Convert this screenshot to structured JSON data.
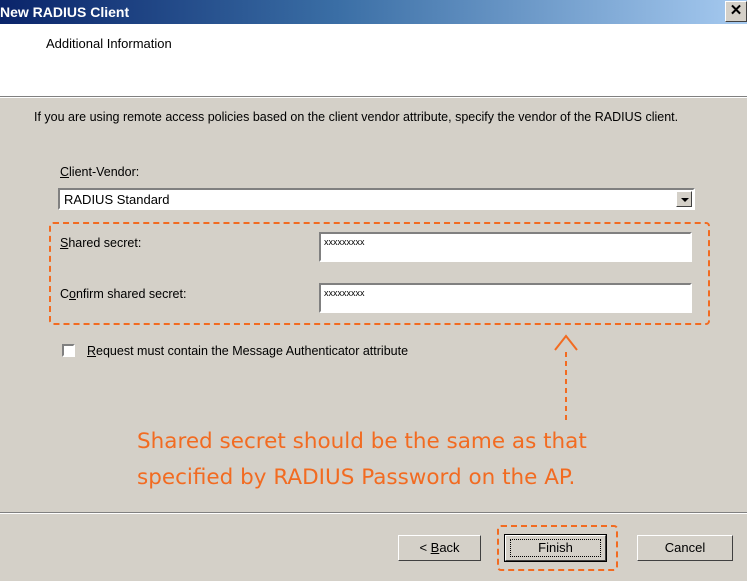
{
  "window": {
    "title": "New RADIUS Client",
    "close_glyph": "✕"
  },
  "header": {
    "section_title": "Additional Information"
  },
  "main": {
    "description": "If you are using remote access policies based on the client vendor attribute, specify the vendor of the RADIUS client.",
    "client_vendor": {
      "label_mnemonic": "C",
      "label_rest": "lient-Vendor:",
      "selected": "RADIUS Standard"
    },
    "shared_secret": {
      "label_mnemonic": "S",
      "label_rest": "hared secret:",
      "value": "xxxxxxxxx"
    },
    "confirm_secret": {
      "label_mnemonic": "o",
      "label_prefix": "C",
      "label_rest": "nfirm shared secret:",
      "value": "xxxxxxxxx"
    },
    "message_authenticator": {
      "checked": false,
      "label_mnemonic": "R",
      "label_rest": "equest must contain the Message Authenticator attribute"
    }
  },
  "annotation": {
    "line1": "Shared secret should be the same as that",
    "line2": "specified by RADIUS Password on the AP.",
    "color": "#f26b21"
  },
  "footer": {
    "back": {
      "prefix": "< ",
      "mnemonic": "B",
      "rest": "ack"
    },
    "finish": "Finish",
    "cancel": "Cancel"
  }
}
